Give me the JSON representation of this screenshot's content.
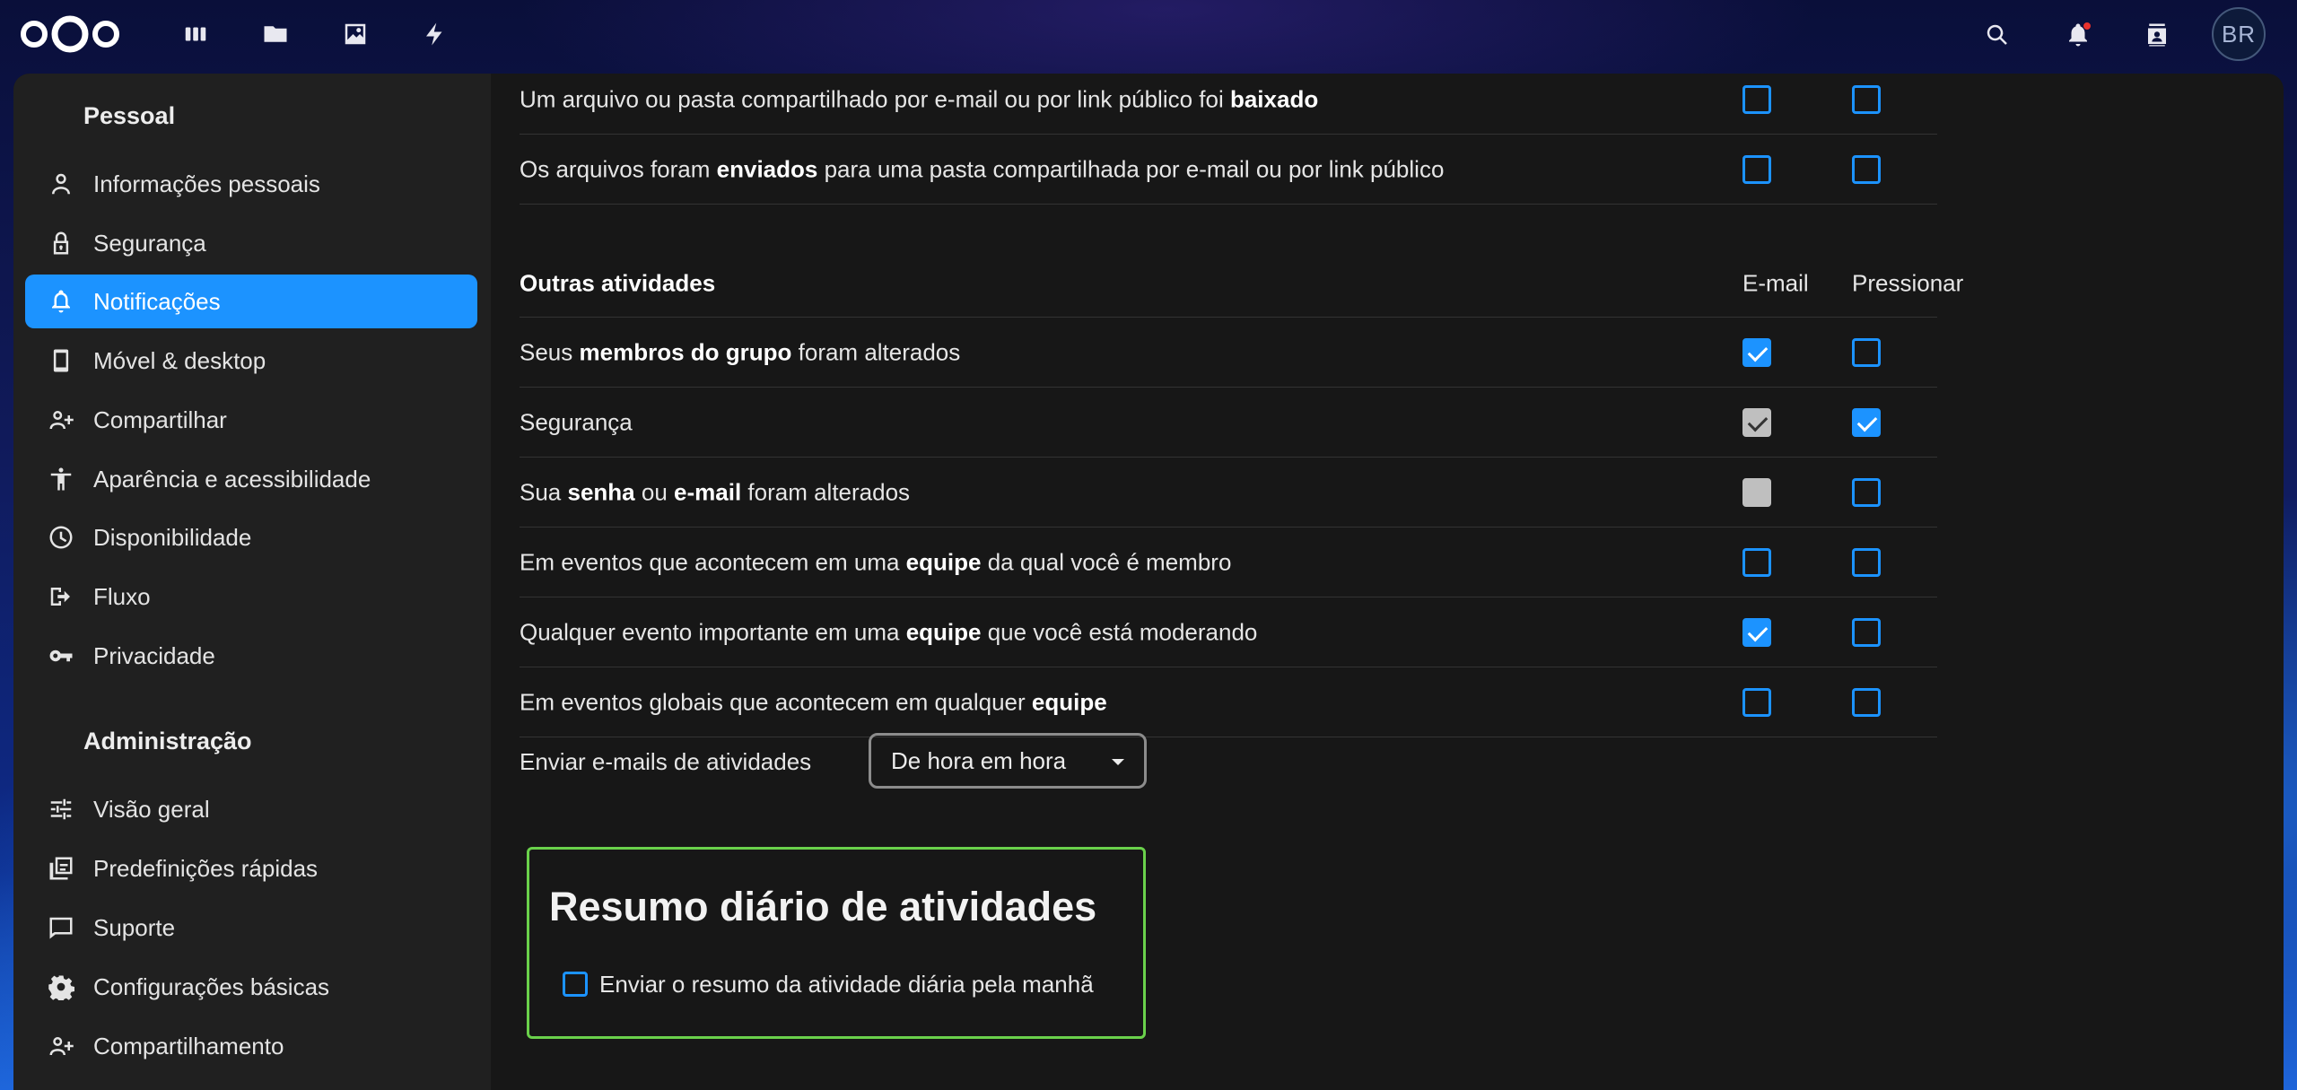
{
  "header": {
    "apps": [
      "dashboard-icon",
      "files-icon",
      "photos-icon",
      "activity-icon"
    ],
    "avatar_initials": "BR"
  },
  "sidebar": {
    "personal_heading": "Pessoal",
    "personal_items": [
      {
        "label": "Informações pessoais",
        "icon": "user-icon"
      },
      {
        "label": "Segurança",
        "icon": "lock-icon"
      },
      {
        "label": "Notificações",
        "icon": "bell-icon",
        "active": true
      },
      {
        "label": "Móvel & desktop",
        "icon": "phone-icon"
      },
      {
        "label": "Compartilhar",
        "icon": "share-user-icon"
      },
      {
        "label": "Aparência e acessibilidade",
        "icon": "accessibility-icon"
      },
      {
        "label": "Disponibilidade",
        "icon": "clock-icon"
      },
      {
        "label": "Fluxo",
        "icon": "flow-icon"
      },
      {
        "label": "Privacidade",
        "icon": "key-icon"
      }
    ],
    "admin_heading": "Administração",
    "admin_items": [
      {
        "label": "Visão geral",
        "icon": "sliders-icon"
      },
      {
        "label": "Predefinições rápidas",
        "icon": "presets-icon"
      },
      {
        "label": "Suporte",
        "icon": "support-icon"
      },
      {
        "label": "Configurações básicas",
        "icon": "gear-icon"
      },
      {
        "label": "Compartilhamento",
        "icon": "share-user-icon"
      }
    ]
  },
  "content": {
    "top_rows": [
      {
        "pre": "Um arquivo ou pasta compartilhado por e-mail ou por link público foi ",
        "bold": "baixado",
        "post": "",
        "email": false,
        "push": false
      },
      {
        "pre": "Os arquivos foram ",
        "bold": "enviados",
        "post": " para uma pasta compartilhada por e-mail ou por link público",
        "email": false,
        "push": false
      }
    ],
    "section_title": "Outras atividades",
    "col_email": "E-mail",
    "col_push": "Pressionar",
    "rows": [
      {
        "pre": "Seus ",
        "bold": "membros do grupo",
        "post": " foram alterados",
        "email": "checked",
        "push": "unchecked"
      },
      {
        "pre": "Segurança",
        "bold": "",
        "post": "",
        "email": "grey-checked",
        "push": "checked"
      },
      {
        "pre": "Sua ",
        "bold": "senha",
        "mid": " ou ",
        "bold2": "e-mail",
        "post": " foram alterados",
        "email": "grey-disabled",
        "push": "unchecked"
      },
      {
        "pre": "Em eventos que acontecem em uma ",
        "bold": "equipe",
        "post": " da qual você é membro",
        "email": "unchecked",
        "push": "unchecked"
      },
      {
        "pre": "Qualquer evento importante em uma ",
        "bold": "equipe",
        "post": " que você está moderando",
        "email": "checked",
        "push": "unchecked"
      },
      {
        "pre": "Em eventos globais que acontecem em qualquer ",
        "bold": "equipe",
        "post": "",
        "email": "unchecked",
        "push": "unchecked"
      }
    ],
    "send_label": "Enviar e-mails de atividades",
    "send_frequency": "De hora em hora",
    "digest_title": "Resumo diário de atividades",
    "digest_option": "Enviar o resumo da atividade diária pela manhã",
    "digest_checked": false
  },
  "colors": {
    "accent": "#1c93ff",
    "highlight_border": "#6ad14b"
  }
}
